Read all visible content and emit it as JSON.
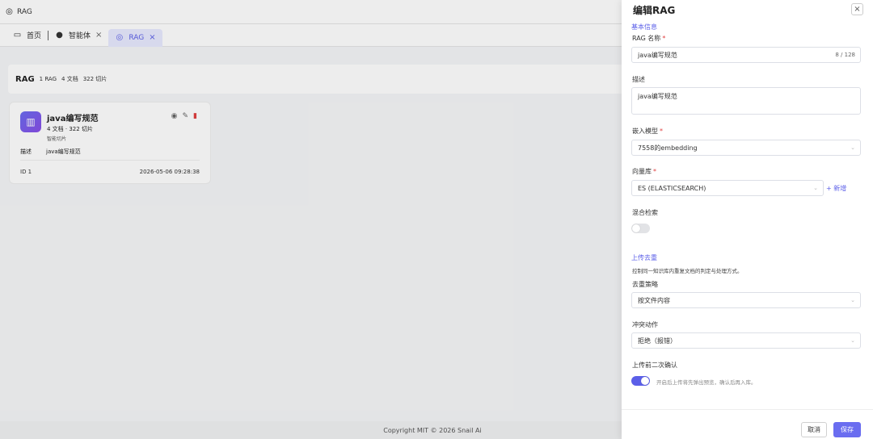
{
  "topbar": {
    "app_title": "RAG"
  },
  "tabs": [
    {
      "label": "首页",
      "closable": false
    },
    {
      "label": "智能体",
      "closable": true
    },
    {
      "label": "RAG",
      "closable": true,
      "active": true
    }
  ],
  "tab_close_glyph": "×",
  "stats": {
    "heading": "RAG",
    "rag_count": "1 RAG",
    "doc_count": "4 文档",
    "chunk_count": "322 切片"
  },
  "card": {
    "title": "java编写规范",
    "meta": "4 文档 · 322 切片",
    "chunk_mode": "智能切片",
    "desc_label": "描述",
    "desc_value": "java编写规范",
    "id_text": "ID 1",
    "timestamp": "2026-05-06 09:28:38"
  },
  "footer": {
    "copyright": "Copyright MIT © 2026 Snail Ai"
  },
  "drawer": {
    "title": "编辑RAG",
    "close_glyph": "×",
    "basic_section": "基本信息",
    "name_label": "RAG 名称",
    "name_value": "java编写规范",
    "name_count": "8 / 128",
    "desc_label": "描述",
    "desc_value": "java编写规范",
    "embed_label": "嵌入模型",
    "embed_value": "7558的embedding",
    "vector_label": "向量库",
    "vector_value": "ES (ELASTICSEARCH)",
    "vector_add": "+ 新增",
    "hybrid_label": "混合检索",
    "hybrid_on": false,
    "dedup_section": "上传去重",
    "dedup_help": "控制同一知识库内重复文档的判定与处理方式。",
    "strategy_label": "去重策略",
    "strategy_value": "按文件内容",
    "conflict_label": "冲突动作",
    "conflict_value": "拒绝（报错）",
    "confirm_label": "上传前二次确认",
    "confirm_on": true,
    "confirm_hint": "开启后上传将先弹出预览，确认后再入库。",
    "required_mark": "*",
    "cancel_label": "取消",
    "save_label": "保存"
  },
  "colors": {
    "accent": "#5b5fe8",
    "danger": "#e04040"
  }
}
